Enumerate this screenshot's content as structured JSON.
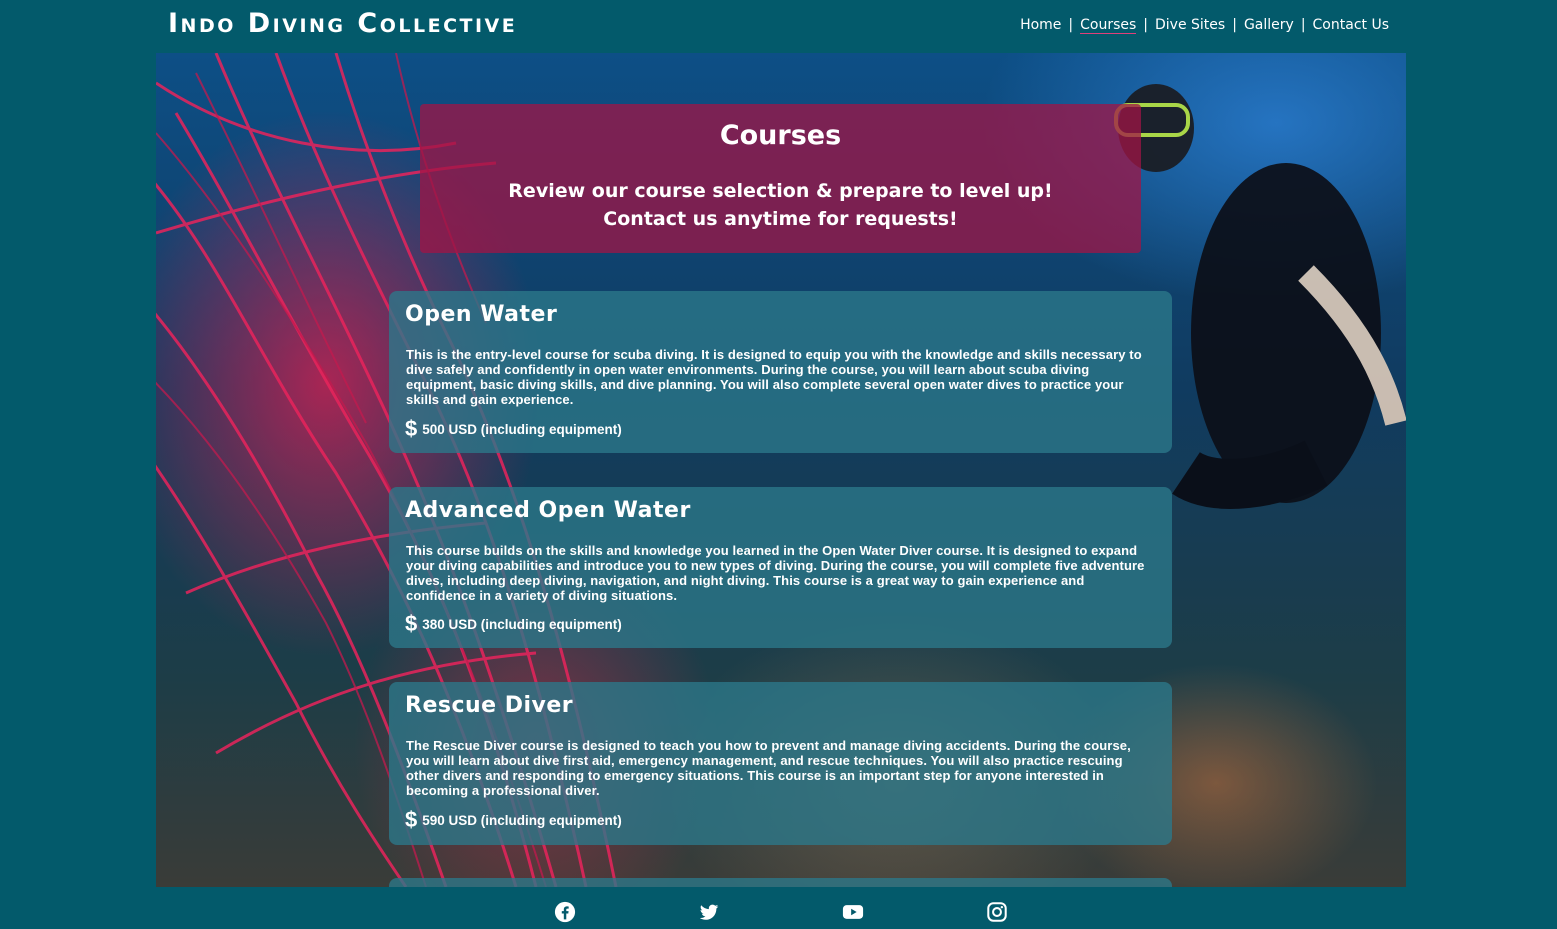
{
  "site": {
    "logo": "Indo Diving Collective"
  },
  "nav": {
    "items": [
      {
        "label": "Home"
      },
      {
        "label": "Courses"
      },
      {
        "label": "Dive Sites"
      },
      {
        "label": "Gallery"
      },
      {
        "label": "Contact Us"
      }
    ],
    "active": "Courses",
    "separator": "|"
  },
  "hero": {
    "title": "Courses",
    "subtitle_line1": "Review our course selection & prepare to level up!",
    "subtitle_line2": "Contact us anytime for requests!"
  },
  "courses": [
    {
      "name": "Open Water",
      "description": "This is the entry-level course for scuba diving. It is designed to equip you with the knowledge and skills necessary to dive safely and confidently in open water environments. During the course, you will learn about scuba diving equipment, basic diving skills, and dive planning. You will also complete several open water dives to practice your skills and gain experience.",
      "price_icon": "dollar-icon",
      "price": "500 USD (including equipment)"
    },
    {
      "name": "Advanced Open Water",
      "description": "This course builds on the skills and knowledge you learned in the Open Water Diver course. It is designed to expand your diving capabilities and introduce you to new types of diving. During the course, you will complete five adventure dives, including deep diving, navigation, and night diving. This course is a great way to gain experience and confidence in a variety of diving situations.",
      "price_icon": "dollar-icon",
      "price": "380 USD (including equipment)"
    },
    {
      "name": "Rescue Diver",
      "description": "The Rescue Diver course is designed to teach you how to prevent and manage diving accidents. During the course, you will learn about dive first aid, emergency management, and rescue techniques. You will also practice rescuing other divers and responding to emergency situations. This course is an important step for anyone interested in becoming a professional diver.",
      "price_icon": "dollar-icon",
      "price": "590 USD (including equipment)"
    }
  ],
  "footer": {
    "social": [
      "facebook-icon",
      "twitter-icon",
      "youtube-icon",
      "instagram-icon"
    ]
  },
  "colors": {
    "page_bg": "#035a6b",
    "title_box": "#a01446",
    "card": "#2b788a",
    "accent": "#e0407a"
  }
}
